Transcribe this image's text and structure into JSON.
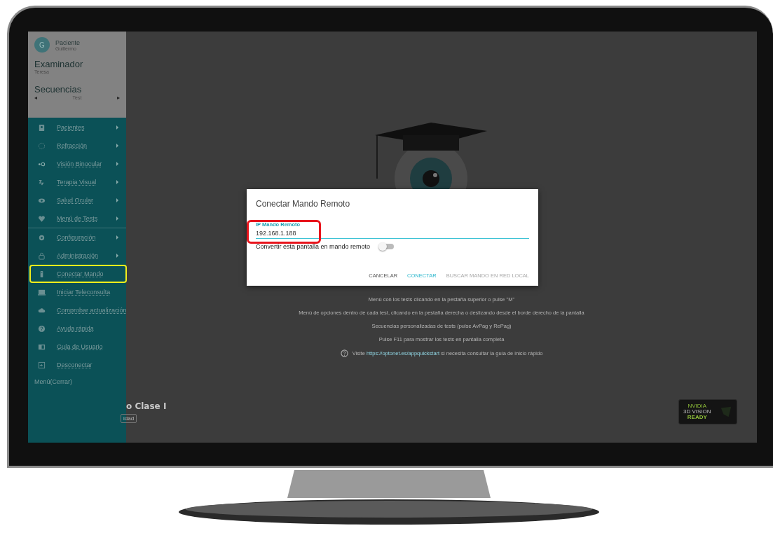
{
  "sidebar": {
    "patient": {
      "avatar": "G",
      "label": "Paciente",
      "name": "Guillermo"
    },
    "examiner": {
      "label": "Examinador",
      "name": "Teresa"
    },
    "sequences": {
      "label": "Secuencias",
      "prev": "◂",
      "value": "Test",
      "next": "▸"
    },
    "items": [
      {
        "label": "Pacientes",
        "submenu": true,
        "highlighted": false,
        "divider_after": false
      },
      {
        "label": "Refracción",
        "submenu": true,
        "highlighted": false,
        "divider_after": false
      },
      {
        "label": "Visión Binocular",
        "submenu": true,
        "highlighted": false,
        "divider_after": false
      },
      {
        "label": "Terapia Visual",
        "submenu": true,
        "highlighted": false,
        "divider_after": false
      },
      {
        "label": "Salud Ocular",
        "submenu": true,
        "highlighted": false,
        "divider_after": false
      },
      {
        "label": "Menú de Tests",
        "submenu": true,
        "highlighted": false,
        "divider_after": true
      },
      {
        "label": "Configuración",
        "submenu": true,
        "highlighted": false,
        "divider_after": false
      },
      {
        "label": "Administración",
        "submenu": true,
        "highlighted": false,
        "divider_after": false
      },
      {
        "label": "Conectar Mando",
        "submenu": false,
        "highlighted": true,
        "divider_after": false
      },
      {
        "label": "Iniciar Teleconsulta",
        "submenu": false,
        "highlighted": false,
        "divider_after": false
      },
      {
        "label": "Comprobar actualización",
        "submenu": false,
        "highlighted": false,
        "divider_after": false
      },
      {
        "label": "Ayuda rápida",
        "submenu": false,
        "highlighted": false,
        "divider_after": false
      },
      {
        "label": "Guía de Usuario",
        "submenu": false,
        "highlighted": false,
        "divider_after": false
      },
      {
        "label": "Desconectar",
        "submenu": false,
        "highlighted": false,
        "divider_after": false
      }
    ],
    "close": "Menú(Cerrar)"
  },
  "main": {
    "tips": [
      "Menú con los tests clicando en la pestaña superior o pulse \"M\"",
      "Menú de opciones dentro de cada test, clicando en la pestaña derecha o deslizando desde el borde derecho de la pantalla",
      "Secuencias personalizadas de tests (pulse AvPag y RePag)",
      "Pulse F11 para mostrar los tests en pantalla completa"
    ],
    "help": {
      "before": "Visite",
      "link": "https://optonet.es/appquickstart",
      "after": "si necesita consultar la guía de inicio rápido"
    },
    "section_title": "o Clase I",
    "section_tag": "idad",
    "badge": {
      "brand": "NVIDIA",
      "product": "3D VISION",
      "status": "READY"
    }
  },
  "dialog": {
    "title": "Conectar Mando Remoto",
    "field": {
      "label": "IP Mando Remoto",
      "value": "192.168.1.188",
      "highlighted": true
    },
    "toggle": {
      "label": "Convertir esta pantalla en mando remoto",
      "on": false
    },
    "buttons": [
      {
        "label": "CANCELAR",
        "kind": "plain",
        "disabled": false
      },
      {
        "label": "CONECTAR",
        "kind": "primary",
        "disabled": false
      },
      {
        "label": "BUSCAR MANDO EN RED LOCAL",
        "kind": "plain",
        "disabled": true
      }
    ]
  }
}
